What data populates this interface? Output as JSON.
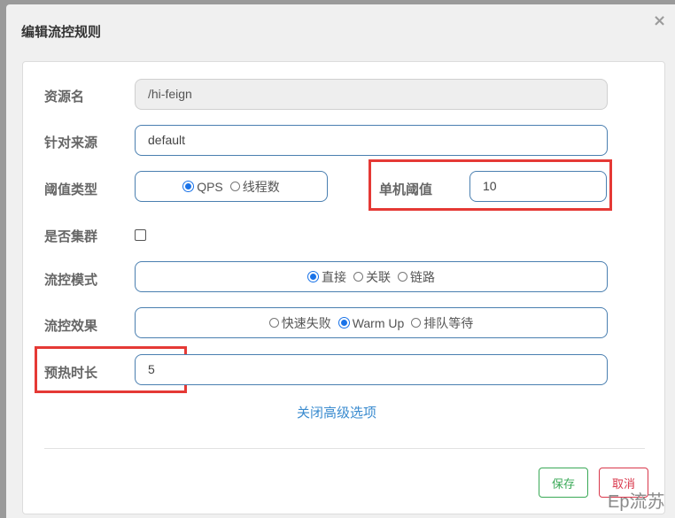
{
  "modal": {
    "title": "编辑流控规则",
    "close_icon": "×"
  },
  "form": {
    "resource": {
      "label": "资源名",
      "value": "/hi-feign"
    },
    "limit_app": {
      "label": "针对来源",
      "value": "default"
    },
    "threshold_type": {
      "label": "阈值类型",
      "options": [
        {
          "label": "QPS",
          "checked": true
        },
        {
          "label": "线程数",
          "checked": false
        }
      ]
    },
    "single_threshold": {
      "label": "单机阈值",
      "value": "10"
    },
    "cluster": {
      "label": "是否集群",
      "checked": false
    },
    "strategy": {
      "label": "流控模式",
      "options": [
        {
          "label": "直接",
          "checked": true
        },
        {
          "label": "关联",
          "checked": false
        },
        {
          "label": "链路",
          "checked": false
        }
      ]
    },
    "control_behavior": {
      "label": "流控效果",
      "options": [
        {
          "label": "快速失败",
          "checked": false
        },
        {
          "label": "Warm Up",
          "checked": true
        },
        {
          "label": "排队等待",
          "checked": false
        }
      ]
    },
    "warmup_period": {
      "label": "预热时长",
      "value": "5"
    },
    "toggle_advanced": "关闭高级选项"
  },
  "footer": {
    "save_label": "保存",
    "cancel_label": "取消"
  },
  "watermark": "Ep流苏",
  "colors": {
    "accent": "#1a73e8",
    "link": "#3a8bcf",
    "save": "#3aa957",
    "cancel": "#d9374b",
    "highlight": "#e53935"
  }
}
